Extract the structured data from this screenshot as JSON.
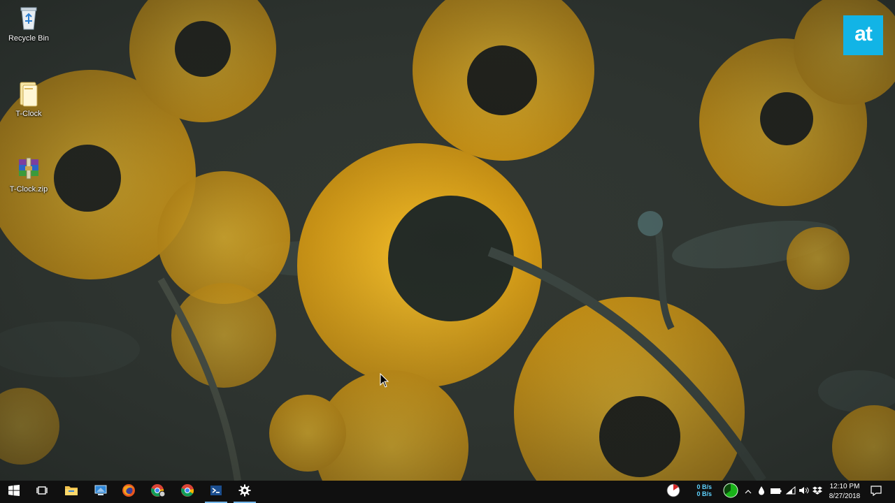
{
  "desktop": {
    "icons": [
      {
        "label": "Recycle Bin",
        "icon": "recycle-bin-icon"
      },
      {
        "label": "T-Clock",
        "icon": "folder-icon"
      },
      {
        "label": "T-Clock.zip",
        "icon": "winrar-archive-icon"
      }
    ],
    "watermark": "at"
  },
  "taskbar": {
    "buttons": [
      {
        "name": "start-button",
        "icon": "windows-logo-icon"
      },
      {
        "name": "task-view-button",
        "icon": "task-view-icon"
      },
      {
        "name": "file-explorer-button",
        "icon": "folder-icon"
      },
      {
        "name": "remote-desktop-button",
        "icon": "monitor-icon"
      },
      {
        "name": "firefox-button",
        "icon": "firefox-icon"
      },
      {
        "name": "chrome-user-button",
        "icon": "chrome-icon"
      },
      {
        "name": "chrome-button",
        "icon": "chrome-icon"
      },
      {
        "name": "powershell-button",
        "icon": "terminal-icon"
      },
      {
        "name": "settings-button",
        "icon": "gear-icon"
      }
    ],
    "tray": {
      "upload_speed": "0 B/s",
      "download_speed": "0 B/s",
      "clock_time": "12:10 PM",
      "clock_date": "8/27/2018",
      "icons": [
        "cpu-meter-icon",
        "memory-meter-icon",
        "chevron-up-icon",
        "droplet-icon",
        "battery-icon",
        "wifi-icon",
        "volume-icon",
        "dropbox-icon"
      ]
    },
    "accent_color": "#76b9ed"
  }
}
